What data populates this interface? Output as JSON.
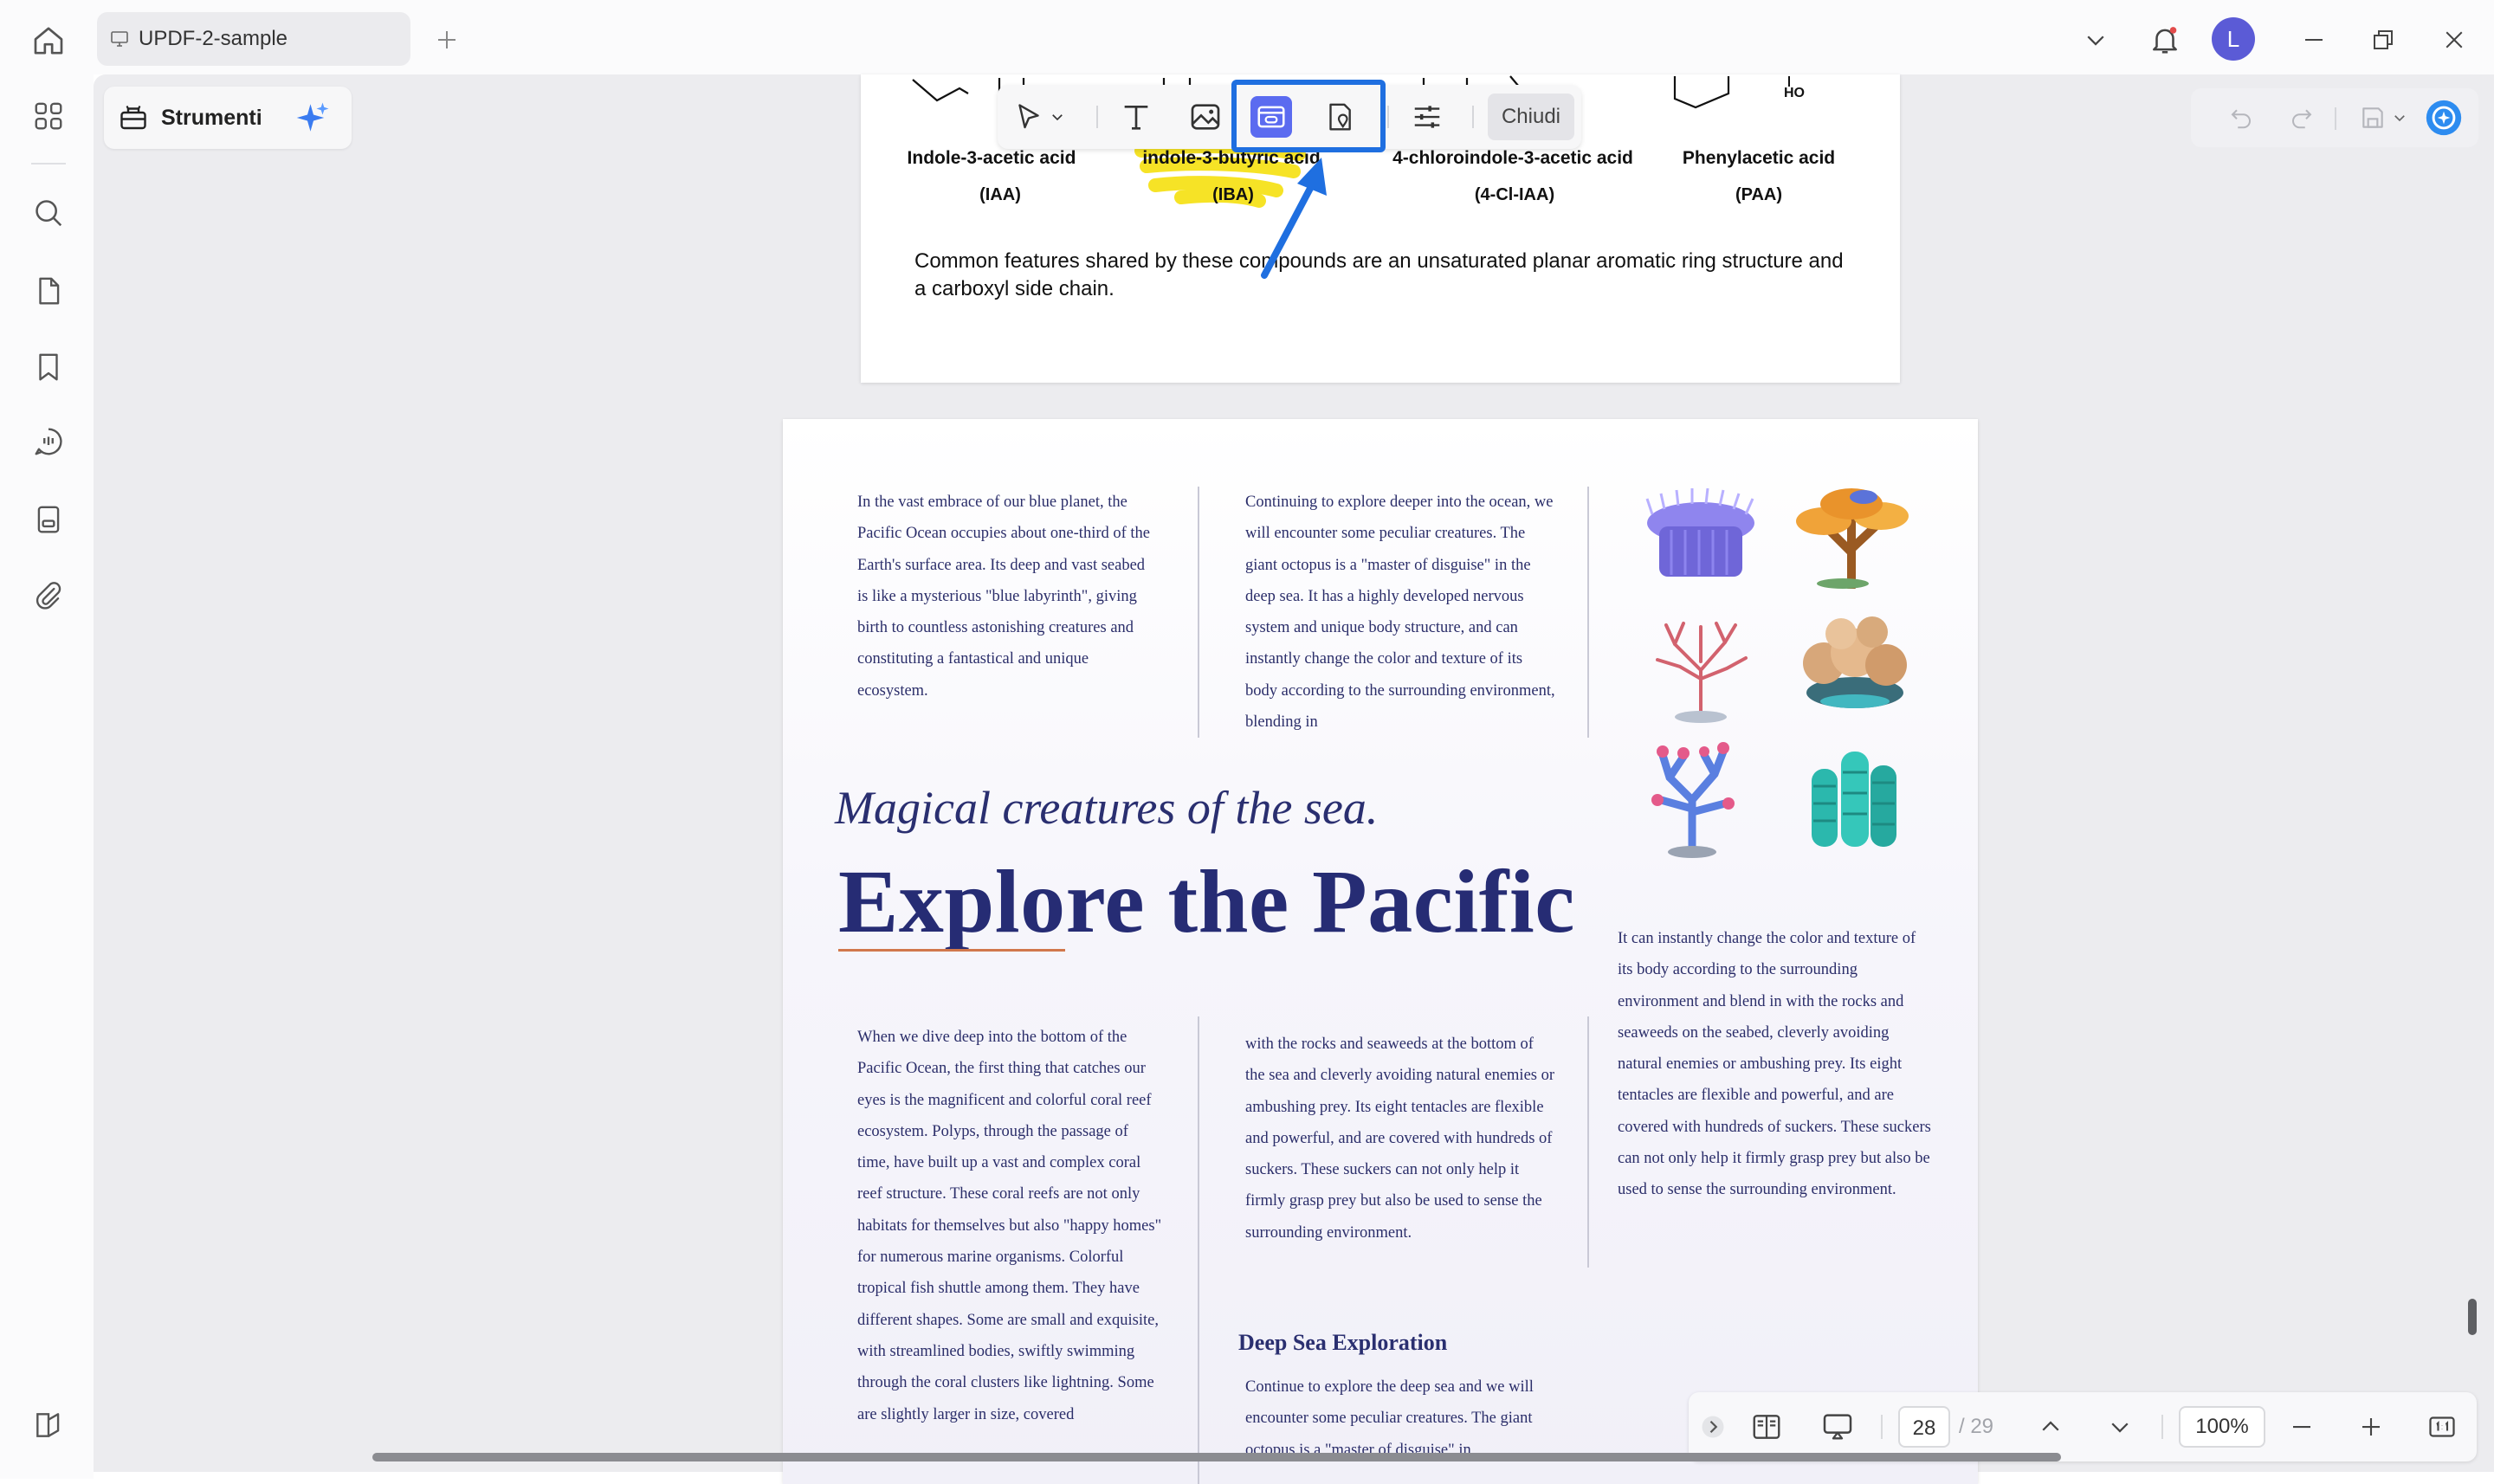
{
  "titlebar": {
    "tab_label": "UPDF-2-sample",
    "avatar_letter": "L",
    "icons": [
      "home-icon",
      "monitor-icon",
      "plus-icon",
      "chevron-down-icon",
      "bell-icon",
      "minimize-icon",
      "restore-icon",
      "close-icon"
    ]
  },
  "tools_panel": {
    "label": "Strumenti",
    "icons": [
      "toolbox-icon",
      "ai-sparkle-icon"
    ]
  },
  "edit_toolbar": {
    "close_label": "Chiudi",
    "icons": [
      "cursor-icon",
      "chevron-down-icon",
      "text-icon",
      "image-icon",
      "link-icon",
      "location-link-icon",
      "settings-sliders-icon"
    ]
  },
  "history": {
    "icons": [
      "undo-icon",
      "redo-icon",
      "save-icon",
      "chevron-down-icon",
      "updf-ai-icon"
    ]
  },
  "sidebar": {
    "icons": [
      "thumbnails-icon",
      "search-icon",
      "page-icon",
      "bookmark-icon",
      "comment-icon",
      "form-icon",
      "attachment-icon",
      "panel-settings-icon"
    ]
  },
  "page_a": {
    "compounds": [
      {
        "name": "Indole-3-acetic acid",
        "abbr": "(IAA)"
      },
      {
        "name": "indole-3-butyric acid",
        "abbr": "(IBA)"
      },
      {
        "name": "4-chloroindole-3-acetic acid",
        "abbr": "(4-Cl-IAA)"
      },
      {
        "name": "Phenylacetic acid",
        "abbr": "(PAA)"
      }
    ],
    "ho_label": "HO",
    "paragraph": "Common features shared by these compounds are an unsaturated planar aromatic ring structure and a carboxyl side chain."
  },
  "page_b": {
    "col1_top": "In the vast embrace of our blue planet, the Pacific Ocean occupies about one-third of the Earth's surface area. Its deep and vast seabed is like a mysterious \"blue labyrinth\", giving birth to countless astonishing creatures and constituting a fantastical and unique ecosystem.",
    "col2_top": "Continuing to explore deeper into the ocean, we will encounter some peculiar creatures. The giant octopus is a \"master of disguise\" in the deep sea. It has a highly developed nervous system and unique body structure, and can instantly change the color and texture of its body according to the surrounding environment, blending in",
    "subtitle": "Magical creatures of the sea.",
    "title": "Explore the Pacific",
    "col3_mid": "It can instantly change the color and texture of its body according to the surrounding environment and blend in with the rocks and seaweeds on the seabed, cleverly avoiding natural enemies or ambushing prey. Its eight tentacles are flexible and powerful, and are covered with hundreds of suckers. These suckers can not only help it firmly grasp prey but also be used to sense the surrounding environment.",
    "col1_bottom": "When we dive deep into the bottom of the Pacific Ocean, the first thing that catches our eyes is the magnificent and colorful coral reef ecosystem. Polyps, through the passage of time, have built up a vast and complex coral reef structure. These coral reefs are not only habitats for themselves but also \"happy homes\" for numerous marine organisms. Colorful tropical fish shuttle among them. They have different shapes. Some are small and exquisite, with streamlined bodies, swiftly swimming through the coral clusters like lightning. Some are slightly larger in size, covered",
    "col2_bottom": "with the rocks and seaweeds at the bottom of the sea and cleverly avoiding natural enemies or ambushing prey. Its eight tentacles are flexible and powerful, and are covered with hundreds of suckers. These suckers can not only help it firmly grasp prey but also be used to sense the surrounding environment.",
    "deep_sea_heading": "Deep Sea Exploration",
    "deep_sea_text": "Continue to explore the deep sea and we will encounter some peculiar creatures. The giant octopus is a \"master of disguise\" in",
    "illustrations": [
      "purple-anemone-icon",
      "orange-coral-icon",
      "pink-coral-icon",
      "mushroom-coral-icon",
      "blue-branch-coral-icon",
      "teal-tube-coral-icon"
    ]
  },
  "statusbar": {
    "current_page": "28",
    "total_pages": "/ 29",
    "zoom": "100%",
    "icons": [
      "chevron-right-icon",
      "page-layout-icon",
      "presentation-icon",
      "chevron-up-icon",
      "chevron-down-icon",
      "zoom-out-icon",
      "zoom-in-icon",
      "actual-size-icon"
    ]
  },
  "colors": {
    "accent": "#1f6fe0",
    "active_tool": "#5b6bf0",
    "highlight": "#f5e11a",
    "magazine_text": "#2b2e6a",
    "title_underline": "#d1774b"
  }
}
